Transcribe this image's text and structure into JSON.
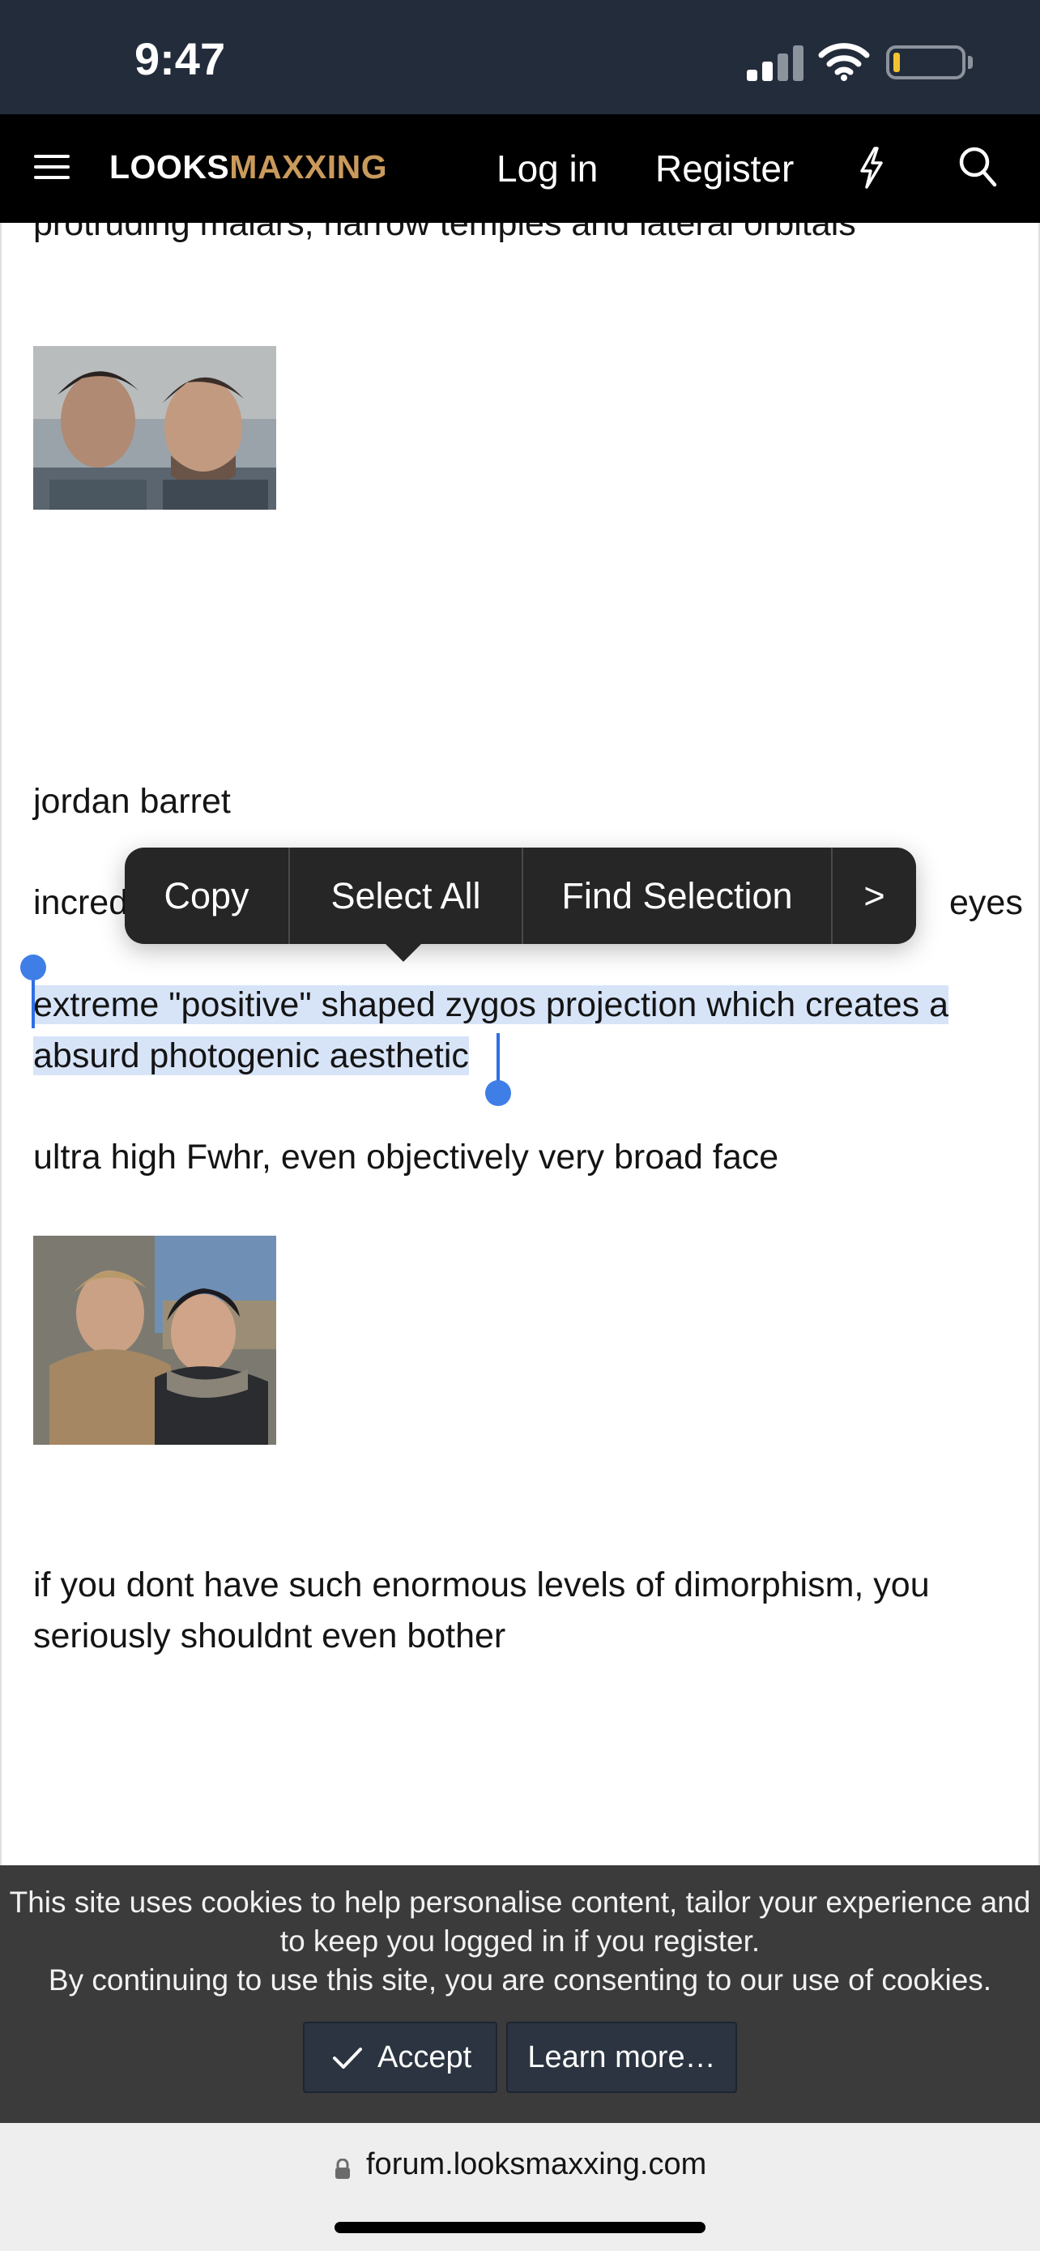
{
  "status_bar": {
    "time": "9:47",
    "background": "#232c3b"
  },
  "nav": {
    "logo_part1": "LOOKS",
    "logo_part2": "MAXXING",
    "logo_accent": "#c99a5b",
    "login_label": "Log in",
    "register_label": "Register",
    "icons": [
      "menu-icon",
      "bolt-icon",
      "search-icon"
    ]
  },
  "post": {
    "line_cut": "protruding malars, narrow temples and lateral orbitals",
    "name": "jordan barret",
    "line_partial_start": "incred",
    "line_partial_end": "eyes",
    "selected_line1": "extreme \"positive\" shaped zygos projection which creates a",
    "selected_line2": "absurd photogenic aesthetic",
    "fwhr_line": "ultra high Fwhr, even objectively very broad face",
    "closing_line1": "if you dont have such enormous levels of dimorphism, you",
    "closing_line2": "seriously shouldnt even bother",
    "selection_color": "#d7e4f8"
  },
  "context_menu": {
    "copy": "Copy",
    "select_all": "Select All",
    "find_selection": "Find Selection",
    "more": ">"
  },
  "cookie_banner": {
    "line1": "This site uses cookies to help personalise content, tailor your experience and",
    "line2": "to keep you logged in if you register.",
    "line3": "By continuing to use this site, you are consenting to our use of cookies.",
    "accept_label": "Accept",
    "learn_more_label": "Learn more…"
  },
  "url_bar": {
    "url": "forum.looksmaxxing.com"
  }
}
